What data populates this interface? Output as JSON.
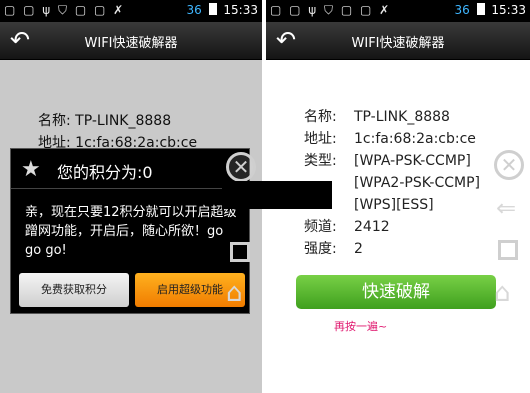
{
  "status_bar": {
    "left_icons": [
      "status-icon-1",
      "status-icon-2",
      "usb-icon",
      "shield-icon",
      "app-icon",
      "app-icon",
      "run-icon"
    ],
    "left_glyphs": "▢ ▢ ψ ⛉ ▢ ▢ ✗",
    "signal_label": "36",
    "time": "15:33"
  },
  "title_bar": {
    "title": "WIFI快速破解器",
    "back_icon": "back-arrow-icon"
  },
  "left_screen": {
    "dimmed_rows": [
      "名称: TP-LINK_8888",
      "地址: 1c:fa:68:2a:cb:ce"
    ],
    "dialog": {
      "title": "您的积分为:0",
      "message": "亲，现在只要12积分就可以开启超级蹭网功能，开启后，随心所欲！go go go!",
      "free_points_button": "免费获取积分",
      "super_mode_button": "启用超级功能"
    }
  },
  "right_screen": {
    "network": {
      "name_label": "名称:",
      "name_value": "TP-LINK_8888",
      "address_label": "地址:",
      "address_value": "1c:fa:68:2a:cb:ce",
      "type_label": "类型:",
      "type_value": "[WPA-PSK-CCMP][WPA2-PSK-CCMP][WPS][ESS]",
      "channel_label": "频道:",
      "channel_value": "2412",
      "strength_label": "强度:",
      "strength_value": "2"
    },
    "crack_button": "快速破解",
    "retry_hint": "再按一遍~"
  }
}
